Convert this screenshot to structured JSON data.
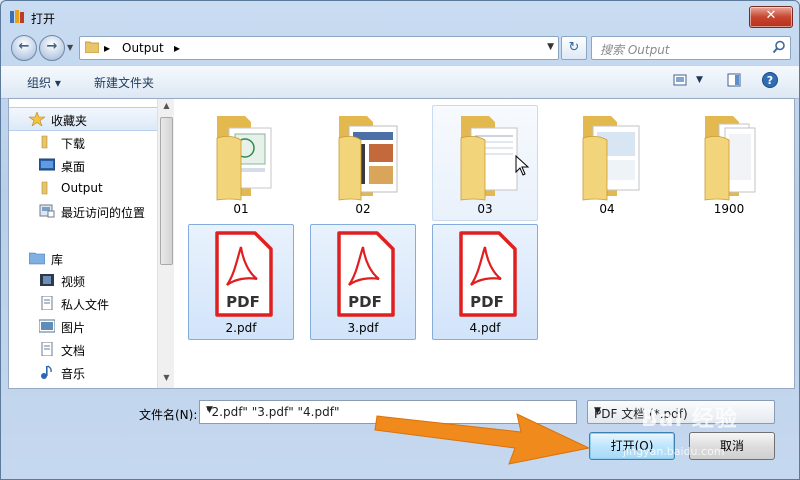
{
  "window": {
    "title": "打开",
    "close_label": "✕"
  },
  "navbar": {
    "back_icon": "back-arrow-icon",
    "forward_icon": "forward-arrow-icon",
    "address_crumb": "Output",
    "search_placeholder": "搜索 Output"
  },
  "toolbar": {
    "organize": "组织 ▾",
    "new_folder": "新建文件夹"
  },
  "sidebar": {
    "items": [
      {
        "label": "收藏夹",
        "icon": "star-icon"
      },
      {
        "label": "下载",
        "icon": "folder-icon"
      },
      {
        "label": "桌面",
        "icon": "desktop-icon"
      },
      {
        "label": "Output",
        "icon": "folder-icon"
      },
      {
        "label": "最近访问的位置",
        "icon": "recent-places-icon"
      },
      {
        "label": "库",
        "icon": "library-icon"
      },
      {
        "label": "视频",
        "icon": "video-icon"
      },
      {
        "label": "私人文件",
        "icon": "document-icon"
      },
      {
        "label": "图片",
        "icon": "picture-icon"
      },
      {
        "label": "文档",
        "icon": "document-icon"
      },
      {
        "label": "音乐",
        "icon": "music-icon"
      }
    ]
  },
  "files": [
    {
      "name": "01",
      "kind": "folder",
      "selected": false
    },
    {
      "name": "02",
      "kind": "folder",
      "selected": false
    },
    {
      "name": "03",
      "kind": "folder",
      "selected": false,
      "hover": true
    },
    {
      "name": "04",
      "kind": "folder",
      "selected": false
    },
    {
      "name": "1900",
      "kind": "folder",
      "selected": false
    },
    {
      "name": "2.pdf",
      "kind": "pdf",
      "selected": true
    },
    {
      "name": "3.pdf",
      "kind": "pdf",
      "selected": true
    },
    {
      "name": "4.pdf",
      "kind": "pdf",
      "selected": true
    }
  ],
  "pdf_badge": "PDF",
  "bottom": {
    "filename_label": "文件名(N):",
    "filename_value": "\"2.pdf\" \"3.pdf\" \"4.pdf\"",
    "filetype_value": "PDF 文档 (*.pdf)",
    "open_button": "打开(O)",
    "cancel_button": "取消"
  },
  "overlay": {
    "watermark": "Bai 经验",
    "watermark_url": "jingyan.baidu.com"
  },
  "colors": {
    "accent": "#3c7fb1",
    "pdf_red": "#e02020",
    "arrow_orange": "#f08a1c"
  }
}
